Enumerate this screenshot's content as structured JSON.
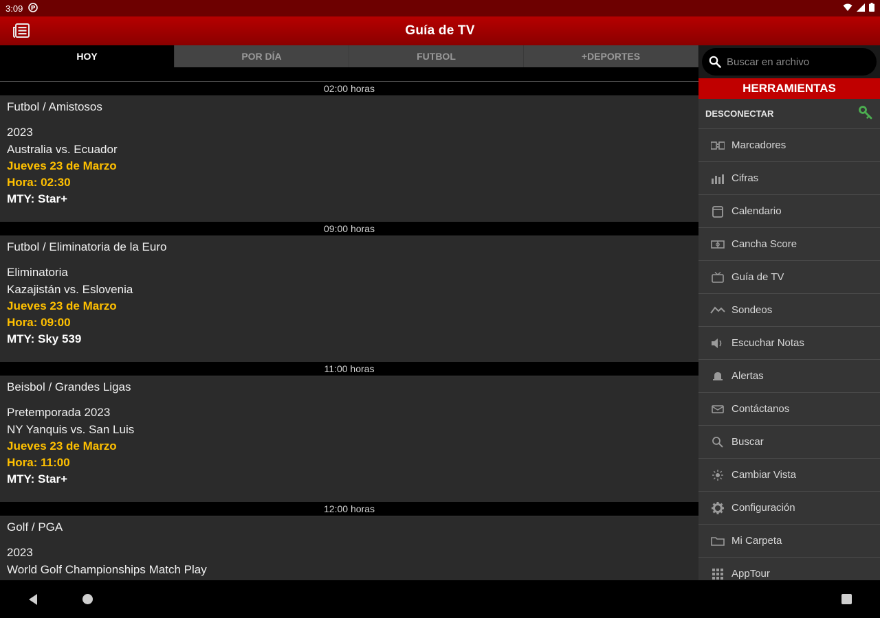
{
  "status": {
    "time": "3:09"
  },
  "appbar": {
    "title": "Guía de TV"
  },
  "tabs": [
    {
      "label": "HOY",
      "active": true
    },
    {
      "label": "POR DÍA",
      "active": false
    },
    {
      "label": "FUTBOL",
      "active": false
    },
    {
      "label": "+DEPORTES",
      "active": false
    }
  ],
  "events": [
    {
      "hour": "02:00 horas",
      "sport": "Futbol / Amistosos",
      "line1": "2023",
      "line2": "Australia vs. Ecuador",
      "date": "Jueves 23 de Marzo",
      "time": "Hora: 02:30",
      "channel": "MTY: Star+"
    },
    {
      "hour": "09:00 horas",
      "sport": "Futbol / Eliminatoria de la Euro",
      "line1": "Eliminatoria",
      "line2": "Kazajistán vs. Eslovenia",
      "date": "Jueves 23 de Marzo",
      "time": "Hora: 09:00",
      "channel": "MTY: Sky 539"
    },
    {
      "hour": "11:00 horas",
      "sport": "Beisbol / Grandes Ligas",
      "line1": "Pretemporada 2023",
      "line2": "NY Yanquis vs. San Luis",
      "date": "Jueves 23 de Marzo",
      "time": "Hora: 11:00",
      "channel": "MTY: Star+"
    },
    {
      "hour": "12:00 horas",
      "sport": "Golf / PGA",
      "line1": "2023",
      "line2": "World Golf Championships Match Play"
    }
  ],
  "panel": {
    "search_placeholder": "Buscar en archivo",
    "tools_header": "HERRAMIENTAS",
    "disconnect_label": "DESCONECTAR",
    "items": [
      {
        "label": "Marcadores",
        "icon": "scoreboard-icon"
      },
      {
        "label": "Cifras",
        "icon": "stats-icon"
      },
      {
        "label": "Calendario",
        "icon": "calendar-icon"
      },
      {
        "label": "Cancha Score",
        "icon": "field-icon"
      },
      {
        "label": "Guía de TV",
        "icon": "tv-icon"
      },
      {
        "label": "Sondeos",
        "icon": "poll-icon"
      },
      {
        "label": "Escuchar Notas",
        "icon": "speaker-icon"
      },
      {
        "label": "Alertas",
        "icon": "alert-icon"
      },
      {
        "label": "Contáctanos",
        "icon": "contact-icon"
      },
      {
        "label": "Buscar",
        "icon": "search-icon"
      },
      {
        "label": "Cambiar Vista",
        "icon": "brightness-icon"
      },
      {
        "label": "Configuración",
        "icon": "gear-icon"
      },
      {
        "label": "Mi Carpeta",
        "icon": "folder-icon"
      },
      {
        "label": "AppTour",
        "icon": "grid-icon"
      }
    ]
  },
  "colors": {
    "appbar": "#a80000",
    "accent_yellow": "#ffc000",
    "panel_bg": "#353535",
    "tools_header": "#c00000",
    "key_green": "#4caf50"
  }
}
